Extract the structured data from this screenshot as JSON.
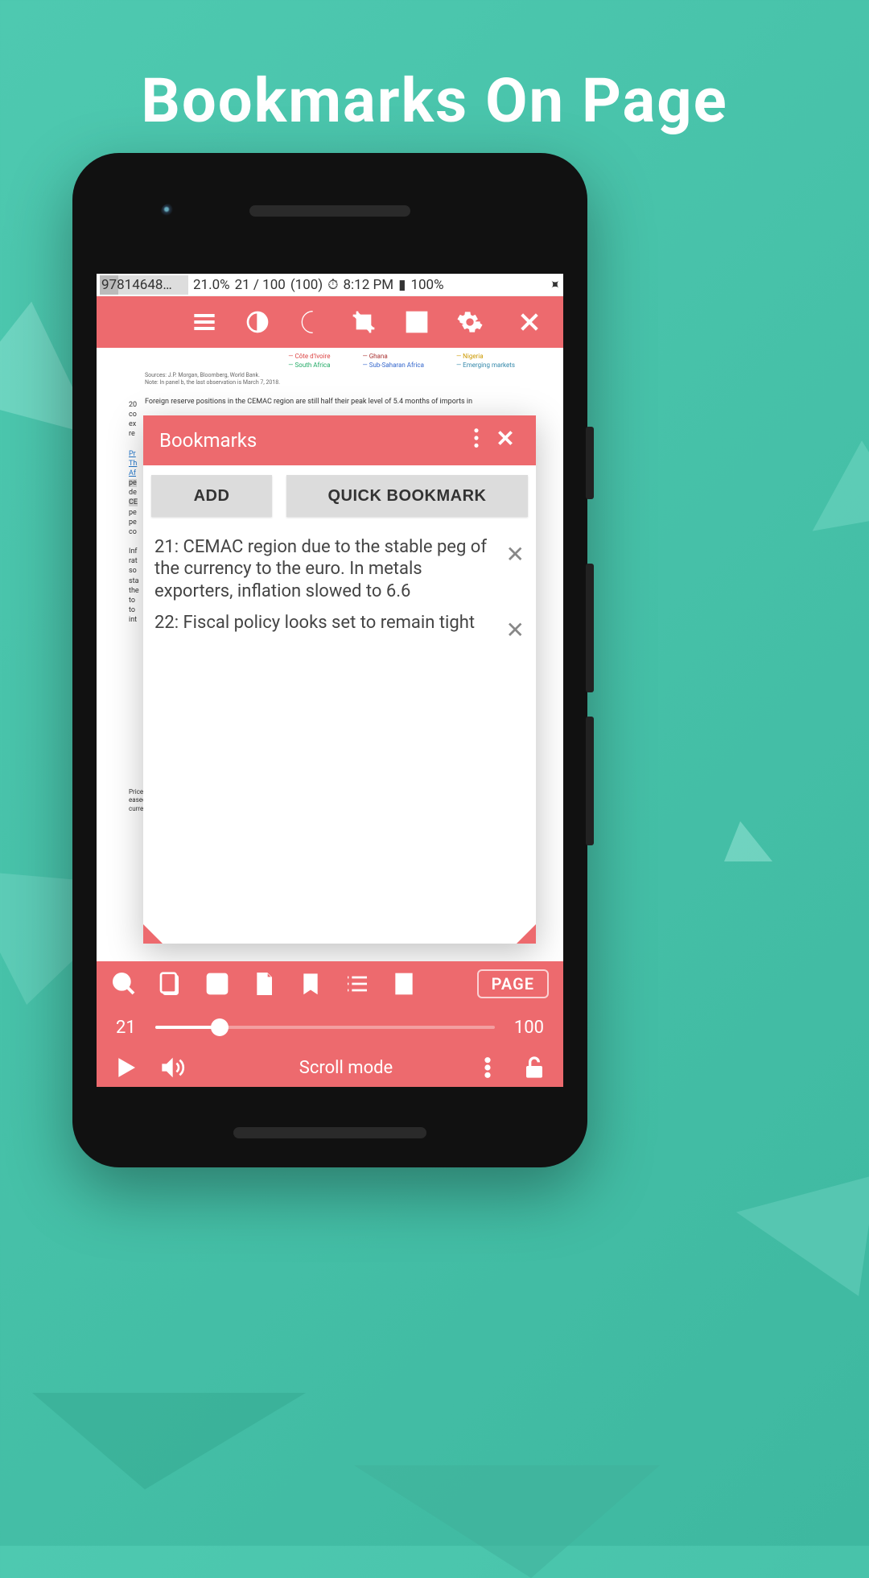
{
  "promo": {
    "title": "Bookmarks On Page"
  },
  "status": {
    "doc_id": "97814648…",
    "percent": "21.0%",
    "page_of": "21 / 100",
    "count": "(100)",
    "time": "8:12 PM",
    "battery": "100%"
  },
  "doc": {
    "src": "Sources: J.P. Morgan, Bloomberg, World Bank.",
    "note": "Note: In panel b, the last observation is March 7, 2018.",
    "legend": {
      "col1": [
        "Côte d'Ivoire",
        "South Africa"
      ],
      "col2": [
        "Ghana",
        "Sub-Saharan Africa"
      ],
      "col3": [
        "Nigeria",
        "Emerging markets"
      ]
    },
    "para": "Foreign reserve positions in the CEMAC region are still half their peak level of 5.4 months of imports in",
    "lower": "Price pressures eased inflation current"
  },
  "dialog": {
    "title": "Bookmarks",
    "add": "ADD",
    "quick": "QUICK BOOKMARK",
    "items": [
      {
        "text": "21: CEMAC region due to the stable peg of the currency to the euro. In metals exporters, inflation slowed to 6.6"
      },
      {
        "text": "22: Fiscal policy looks set to remain tight"
      }
    ]
  },
  "bottom": {
    "page_label": "PAGE",
    "current": "21",
    "total": "100",
    "mode": "Scroll mode"
  }
}
